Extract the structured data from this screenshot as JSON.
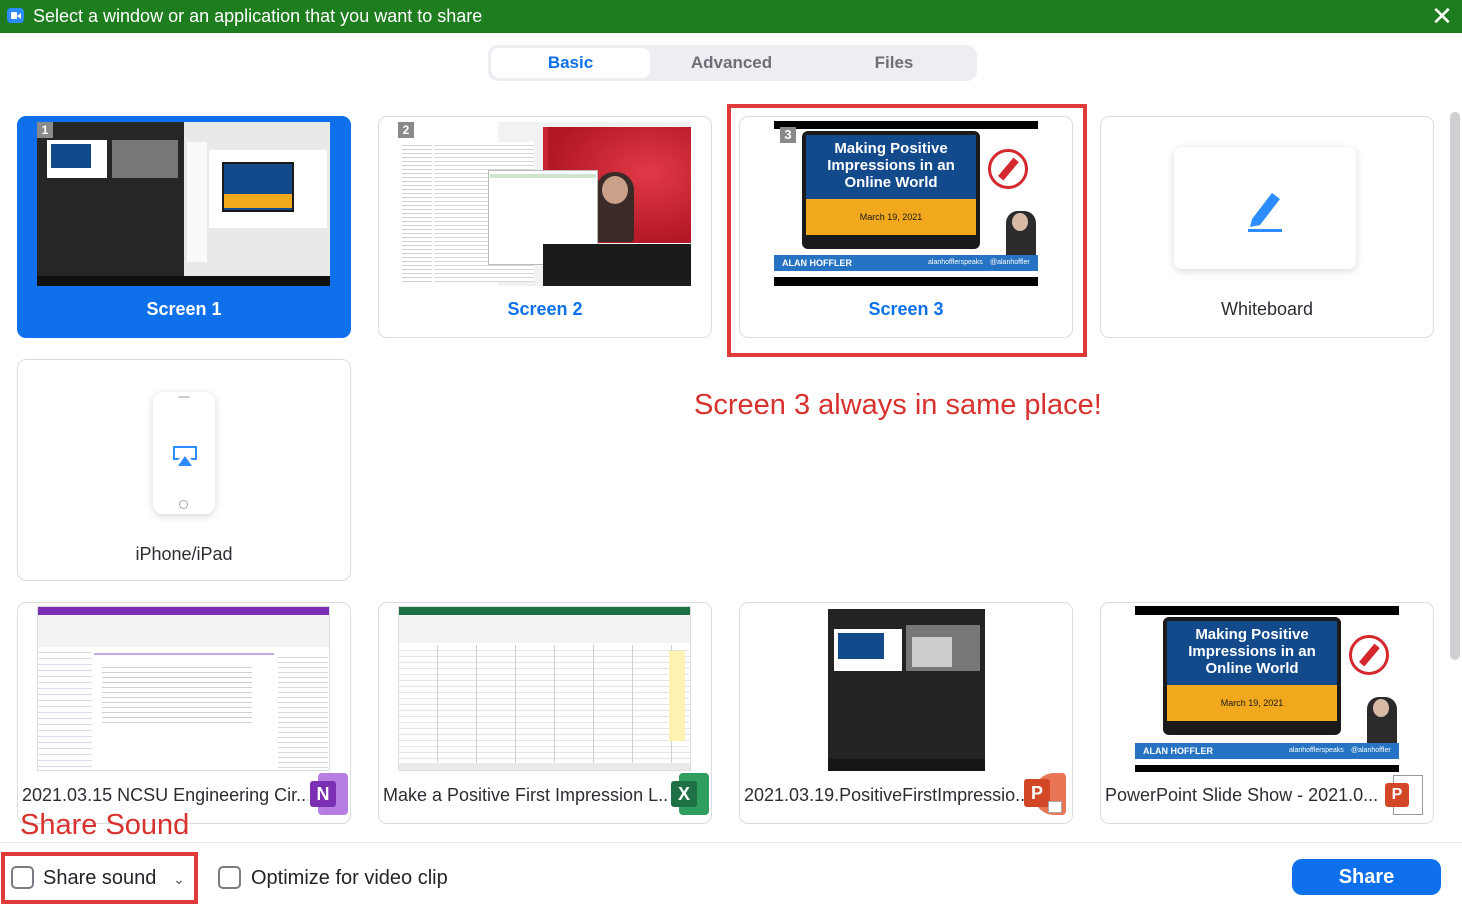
{
  "titlebar": {
    "title": "Select a window or an application that you want to share",
    "close_glyph": "✕"
  },
  "tabs": [
    {
      "label": "Basic",
      "active": true
    },
    {
      "label": "Advanced",
      "active": false
    },
    {
      "label": "Files",
      "active": false
    }
  ],
  "screens": [
    {
      "label": "Screen 1",
      "number": "1",
      "selected": true
    },
    {
      "label": "Screen 2",
      "number": "2",
      "selected": false
    },
    {
      "label": "Screen 3",
      "number": "3",
      "selected": false
    }
  ],
  "whiteboard": {
    "label": "Whiteboard",
    "icon": "pencil-icon"
  },
  "iphone": {
    "label": "iPhone/iPad",
    "icon": "airplay-icon"
  },
  "apps": [
    {
      "label": "2021.03.15 NCSU Engineering Cir...",
      "badge": "N",
      "badge_color": "#7b2fb5",
      "icon": "onenote-icon"
    },
    {
      "label": "Make a Positive First Impression L...",
      "badge": "X",
      "badge_color": "#1e7145",
      "icon": "excel-icon"
    },
    {
      "label": "2021.03.19.PositiveFirstImpressio...",
      "badge": "P",
      "badge_color": "#d24726",
      "icon": "powerpoint-icon"
    },
    {
      "label": "PowerPoint Slide Show  -  2021.0...",
      "badge": "P",
      "badge_color": "#d24726",
      "icon": "powerpoint-show-icon"
    }
  ],
  "slide": {
    "title": "Making Positive Impressions in an Online World",
    "date": "March 19, 2021",
    "brand": "ALAN HOFFLER",
    "social1": "alanhofflerspeaks",
    "social2": "@alanhoffler"
  },
  "annotations": {
    "screen3_note": "Screen 3 always in same place!",
    "share_sound_note": "Share Sound"
  },
  "bottom": {
    "share_sound_label": "Share sound",
    "share_sound_checked": false,
    "optimize_label": "Optimize for video clip",
    "optimize_checked": false,
    "share_button": "Share"
  },
  "colors": {
    "titlebar": "#1e7d1e",
    "accent": "#0e71eb",
    "annotation": "#e03a3a"
  }
}
